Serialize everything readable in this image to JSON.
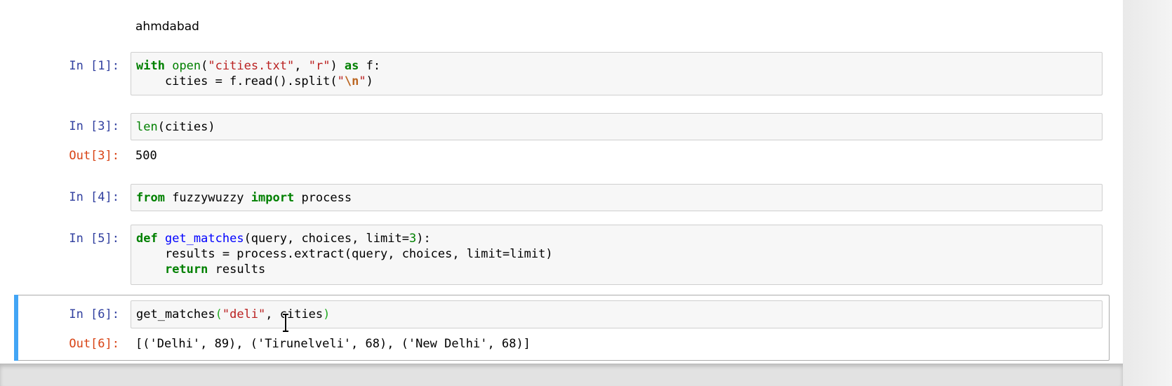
{
  "markdown_output": "ahmdabad",
  "cells": [
    {
      "prompt": "In [1]:",
      "code_lines": [
        {
          "kw1": "with",
          "open": "open",
          "p1": "(",
          "s1": "\"cities.txt\"",
          "c1": ", ",
          "s2": "\"r\"",
          "p2": ") ",
          "kw2": "as",
          "tail": " f:"
        },
        {
          "pre": "    cities = f.read().split(",
          "s_open": "\"",
          "esc": "\\n",
          "s_close": "\"",
          "tail": ")"
        }
      ]
    },
    {
      "prompt": "In [3]:",
      "code": {
        "fn": "len",
        "rest": "(cities)"
      },
      "out_prompt": "Out[3]:",
      "output": "500"
    },
    {
      "prompt": "In [4]:",
      "code": {
        "kw1": "from",
        "mid": " fuzzywuzzy ",
        "kw2": "import",
        "tail": " process"
      }
    },
    {
      "prompt": "In [5]:",
      "code_lines": [
        {
          "kw": "def",
          "sp": " ",
          "name": "get_matches",
          "args": "(query, choices, limit=",
          "num": "3",
          "end": "):"
        },
        {
          "pre": "    results = process.extract(query, choices, limit=limit)"
        },
        {
          "indent": "    ",
          "kw": "return",
          "tail": " results"
        }
      ]
    },
    {
      "prompt": "In [6]:",
      "code": {
        "pre": "get_matches",
        "p_open": "(",
        "str": "\"deli\"",
        "mid": ", cities",
        "p_close": ")"
      },
      "out_prompt": "Out[6]:",
      "output": "[('Delhi', 89), ('Tirunelveli', 68), ('New Delhi', 68)]"
    }
  ],
  "colors": {
    "in_prompt": "#303f9f",
    "out_prompt": "#d84315",
    "keyword": "#008000",
    "string": "#ba2121",
    "selected_cell_bar": "#42a5f5"
  },
  "icons": {
    "cursor": "text-cursor-icon"
  }
}
